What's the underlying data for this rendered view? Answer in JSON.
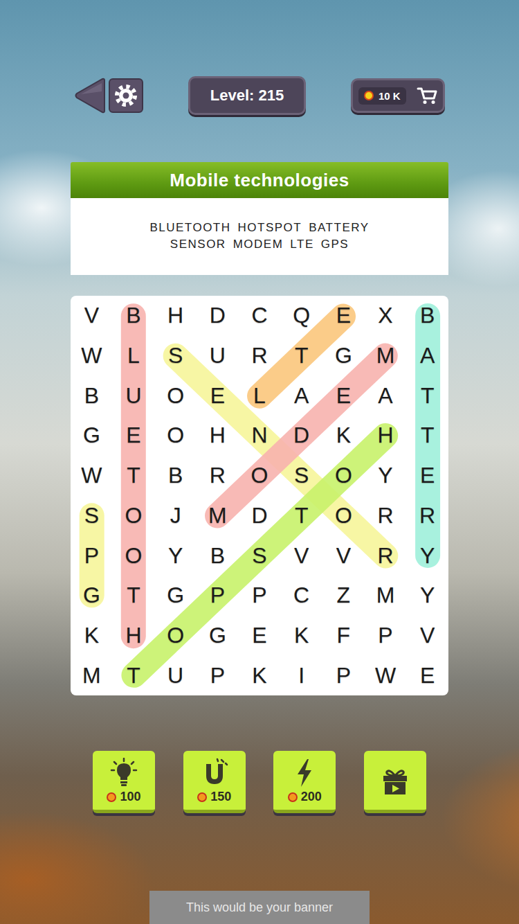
{
  "top_bar": {
    "level": "Level: 215",
    "coins": "10 K"
  },
  "title": "Mobile technologies",
  "words": [
    {
      "text": "BLUETOOTH"
    },
    {
      "text": "HOTSPOT"
    },
    {
      "text": "BATTERY"
    },
    {
      "text": "SENSOR"
    },
    {
      "text": "MODEM"
    },
    {
      "text": "LTE"
    },
    {
      "text": "GPS"
    }
  ],
  "grid": {
    "rows": [
      [
        "V",
        "B",
        "H",
        "D",
        "C",
        "Q",
        "E",
        "X",
        "B"
      ],
      [
        "W",
        "L",
        "S",
        "U",
        "R",
        "T",
        "G",
        "M",
        "A"
      ],
      [
        "B",
        "U",
        "O",
        "E",
        "L",
        "A",
        "E",
        "A",
        "T"
      ],
      [
        "G",
        "E",
        "O",
        "H",
        "N",
        "D",
        "K",
        "H",
        "T"
      ],
      [
        "W",
        "T",
        "B",
        "R",
        "O",
        "S",
        "O",
        "Y",
        "E"
      ],
      [
        "S",
        "O",
        "J",
        "M",
        "D",
        "T",
        "O",
        "R",
        "R"
      ],
      [
        "P",
        "O",
        "Y",
        "B",
        "S",
        "V",
        "V",
        "R",
        "Y"
      ],
      [
        "G",
        "T",
        "G",
        "P",
        "P",
        "C",
        "Z",
        "M",
        "Y"
      ],
      [
        "K",
        "H",
        "O",
        "G",
        "E",
        "K",
        "F",
        "P",
        "V"
      ],
      [
        "M",
        "T",
        "U",
        "P",
        "K",
        "I",
        "P",
        "W",
        "E"
      ]
    ],
    "highlights": [
      {
        "from": {
          "row": 0,
          "col": 1
        },
        "to": {
          "row": 8,
          "col": 1
        },
        "color": "#f7b3ae"
      },
      {
        "from": {
          "row": 0,
          "col": 8
        },
        "to": {
          "row": 6,
          "col": 8
        },
        "color": "#9ff0da"
      },
      {
        "from": {
          "row": 5,
          "col": 0
        },
        "to": {
          "row": 7,
          "col": 0
        },
        "color": "#f6f59a"
      },
      {
        "from": {
          "row": 1,
          "col": 2
        },
        "to": {
          "row": 6,
          "col": 7
        },
        "color": "#f6f59a"
      },
      {
        "from": {
          "row": 1,
          "col": 7
        },
        "to": {
          "row": 5,
          "col": 3
        },
        "color": "#f7b3ae"
      },
      {
        "from": {
          "row": 2,
          "col": 4
        },
        "to": {
          "row": 0,
          "col": 6
        },
        "color": "#fbc67c"
      },
      {
        "from": {
          "row": 3,
          "col": 7
        },
        "to": {
          "row": 9,
          "col": 1
        },
        "color": "#c8f26a"
      }
    ]
  },
  "tools": [
    {
      "kind": "bulb",
      "cost": "100"
    },
    {
      "kind": "magnet",
      "cost": "150"
    },
    {
      "kind": "bolt",
      "cost": "200"
    },
    {
      "kind": "gift"
    }
  ],
  "banner": "This would be your banner"
}
